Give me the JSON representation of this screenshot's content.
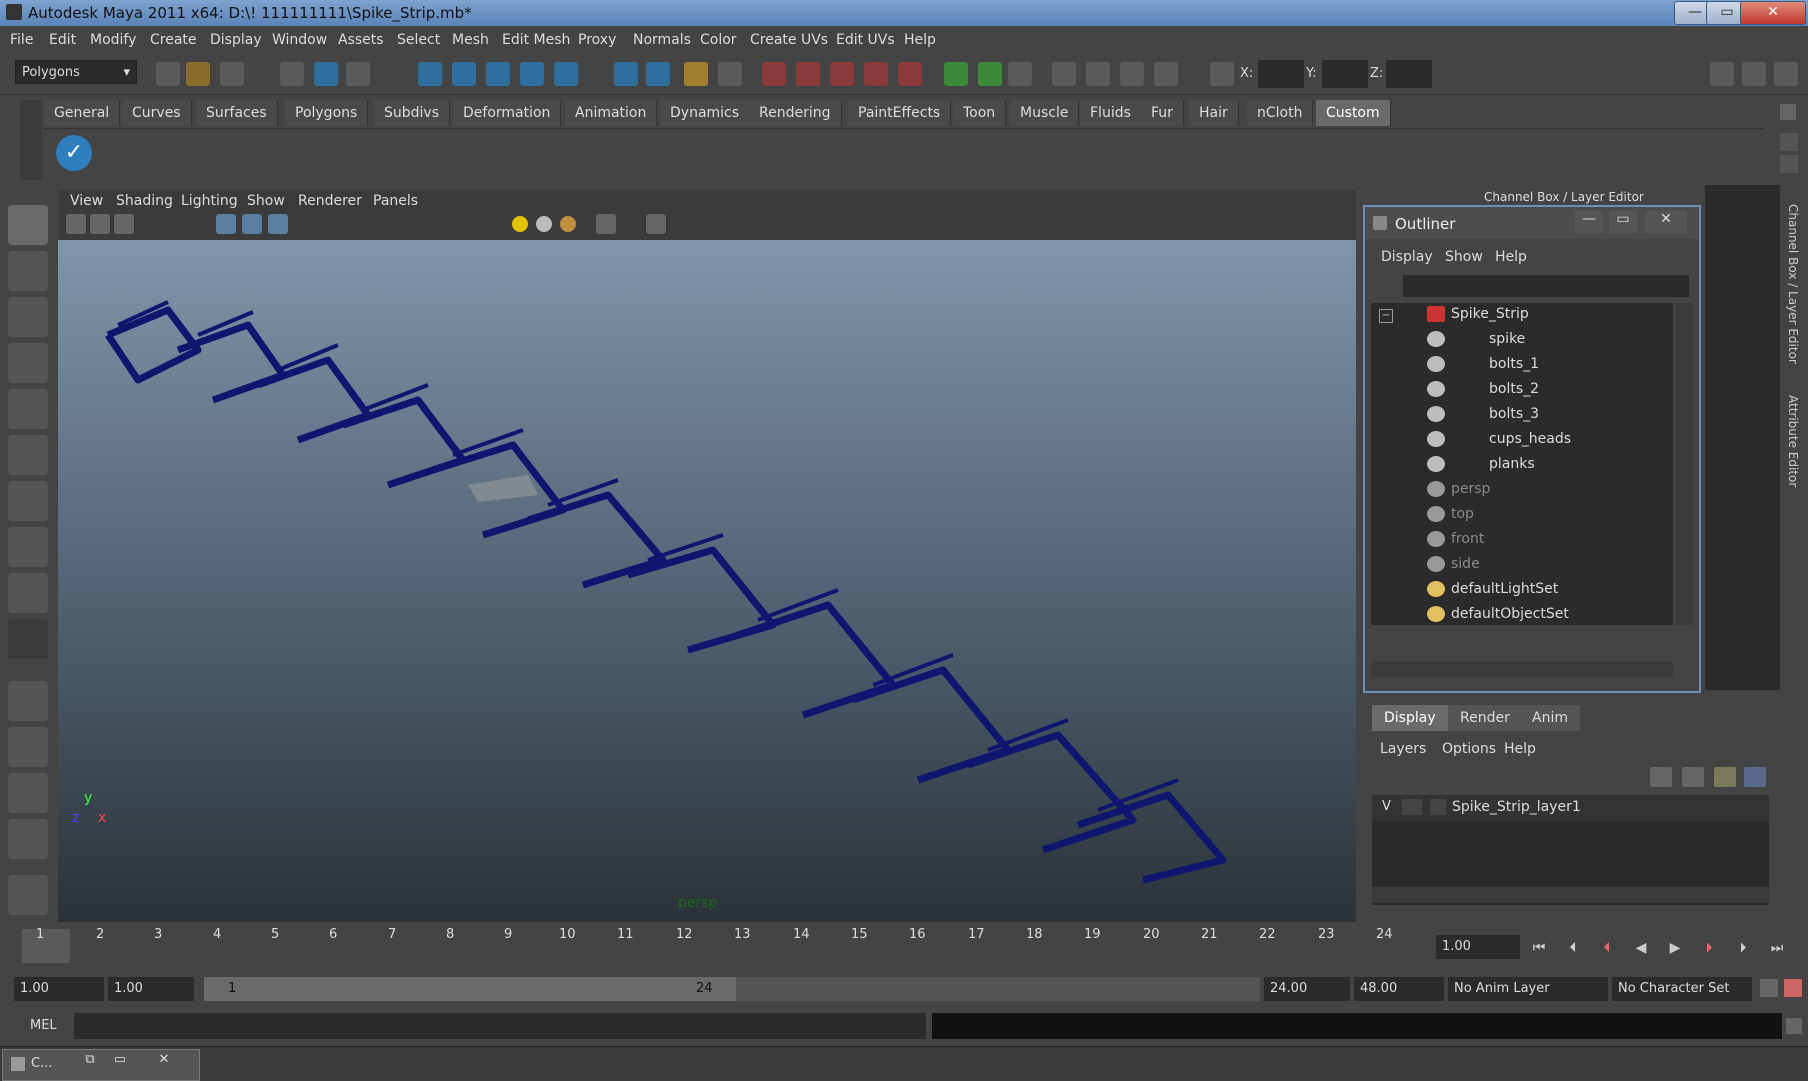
{
  "window": {
    "title": "Autodesk Maya 2011 x64: D:\\! 111111111\\Spike_Strip.mb*",
    "minimize": "—",
    "maximize": "▭",
    "close": "✕"
  },
  "menubar": {
    "items": [
      "File",
      "Edit",
      "Modify",
      "Create",
      "Display",
      "Window",
      "Assets",
      "Select",
      "Mesh",
      "Edit Mesh",
      "Proxy",
      "Normals",
      "Color",
      "Create UVs",
      "Edit UVs",
      "Help"
    ]
  },
  "toolbar": {
    "menu_set": "Polygons",
    "x_label": "X:",
    "y_label": "Y:",
    "z_label": "Z:"
  },
  "shelf": {
    "tabs": [
      "General",
      "Curves",
      "Surfaces",
      "Polygons",
      "Subdivs",
      "Deformation",
      "Animation",
      "Dynamics",
      "Rendering",
      "PaintEffects",
      "Toon",
      "Muscle",
      "Fluids",
      "Fur",
      "Hair",
      "nCloth",
      "Custom"
    ],
    "active": "Custom"
  },
  "viewport": {
    "menus": [
      "View",
      "Shading",
      "Lighting",
      "Show",
      "Renderer",
      "Panels"
    ],
    "camera_label": "persp",
    "axis_y": "y",
    "axis_x": "x",
    "axis_z": "z"
  },
  "channel_box": {
    "title": "Channel Box / Layer Editor",
    "side_tab_channel": "Channel Box / Layer Editor",
    "side_tab_attr": "Attribute Editor"
  },
  "outliner": {
    "title": "Outliner",
    "menus": [
      "Display",
      "Show",
      "Help"
    ],
    "items": [
      {
        "label": "Spike_Strip",
        "dim": false
      },
      {
        "label": "spike",
        "dim": false
      },
      {
        "label": "bolts_1",
        "dim": false
      },
      {
        "label": "bolts_2",
        "dim": false
      },
      {
        "label": "bolts_3",
        "dim": false
      },
      {
        "label": "cups_heads",
        "dim": false
      },
      {
        "label": "planks",
        "dim": false
      },
      {
        "label": "persp",
        "dim": true
      },
      {
        "label": "top",
        "dim": true
      },
      {
        "label": "front",
        "dim": true
      },
      {
        "label": "side",
        "dim": true
      },
      {
        "label": "defaultLightSet",
        "dim": false
      },
      {
        "label": "defaultObjectSet",
        "dim": false
      }
    ]
  },
  "layer_editor": {
    "tabs": [
      "Display",
      "Render",
      "Anim"
    ],
    "menus": [
      "Layers",
      "Options",
      "Help"
    ],
    "layer_vis": "V",
    "layer_name": "Spike_Strip_layer1"
  },
  "timeline": {
    "ticks": [
      "1",
      "2",
      "3",
      "4",
      "5",
      "6",
      "7",
      "8",
      "9",
      "10",
      "11",
      "12",
      "13",
      "14",
      "15",
      "16",
      "17",
      "18",
      "19",
      "20",
      "21",
      "22",
      "23",
      "24"
    ],
    "current_frame": "1.00"
  },
  "range": {
    "start": "1.00",
    "start2": "1.00",
    "range_start": "1",
    "range_end": "24",
    "end": "24.00",
    "end2": "48.00",
    "anim_layer": "No Anim Layer",
    "char_set": "No Character Set"
  },
  "mel": {
    "label": "MEL"
  },
  "taskbar": {
    "label": "C..."
  }
}
